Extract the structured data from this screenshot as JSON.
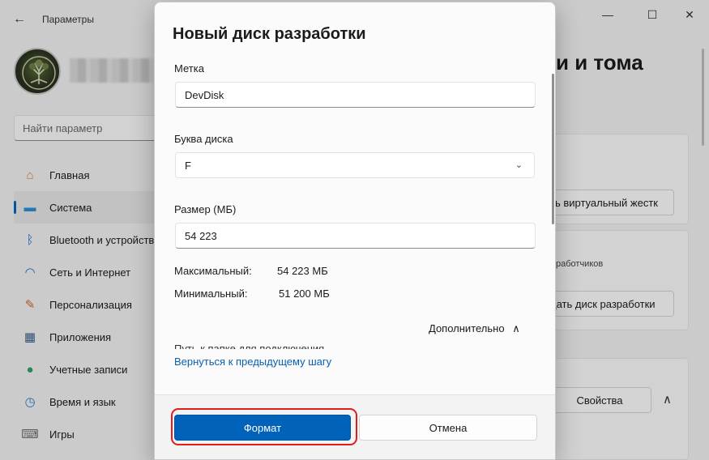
{
  "app": {
    "title": "Параметры",
    "back_glyph": "←",
    "minimize_glyph": "—",
    "maximize_glyph": "☐",
    "close_glyph": "✕"
  },
  "search": {
    "placeholder": "Найти параметр"
  },
  "nav": [
    {
      "label": "Главная",
      "icon": "home-icon",
      "glyph": "⌂",
      "color": "#d9822b"
    },
    {
      "label": "Система",
      "icon": "system-icon",
      "glyph": "▬",
      "color": "#2d8fd6"
    },
    {
      "label": "Bluetooth и устройства",
      "icon": "bluetooth-icon",
      "glyph": "ᛒ",
      "color": "#1f6fd1"
    },
    {
      "label": "Сеть и Интернет",
      "icon": "wifi-icon",
      "glyph": "◠",
      "color": "#1f6fd1"
    },
    {
      "label": "Персонализация",
      "icon": "brush-icon",
      "glyph": "✎",
      "color": "#c66a2a"
    },
    {
      "label": "Приложения",
      "icon": "apps-icon",
      "glyph": "▦",
      "color": "#3a5f8f"
    },
    {
      "label": "Учетные записи",
      "icon": "account-icon",
      "glyph": "●",
      "color": "#2fa36b"
    },
    {
      "label": "Время и язык",
      "icon": "clock-icon",
      "glyph": "◷",
      "color": "#2d7fd0"
    },
    {
      "label": "Игры",
      "icon": "gamepad-icon",
      "glyph": "⌨",
      "color": "#6f6f6f"
    }
  ],
  "background": {
    "heading": "и и тома",
    "btn_virtual": "ть виртуальный жестк",
    "dev_text": "работчиков",
    "btn_create_dev": "дать диск разработки",
    "btn_props": "Свойства",
    "chevron_up": "∧"
  },
  "dialog": {
    "title": "Новый диск разработки",
    "label_label": "Метка",
    "label_value": "DevDisk",
    "letter_label": "Буква диска",
    "letter_value": "F",
    "size_label": "Размер (МБ)",
    "size_value": "54 223",
    "max_label": "Максимальный:",
    "max_value": "54 223 МБ",
    "min_label": "Минимальный:",
    "min_value": "51 200 МБ",
    "advanced_label": "Дополнительно",
    "advanced_chevron": "∧",
    "path_label": "Путь к папке для подключения",
    "back_link": "Вернуться к предыдущему шагу",
    "format_button": "Формат",
    "cancel_button": "Отмена",
    "dropdown_chevron": "⌄"
  },
  "colors": {
    "accent": "#0063b9",
    "highlight": "#e01d1d",
    "link": "#0a5fb0"
  }
}
